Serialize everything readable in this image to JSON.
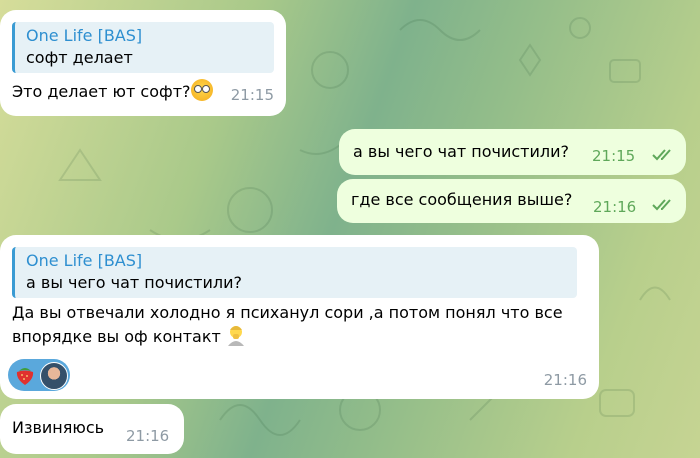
{
  "messages": [
    {
      "reply_author": "One Life [BAS]",
      "reply_text": "софт делает",
      "text": "Это делает ют софт?",
      "emoji": "flushed-face",
      "time": "21:15"
    },
    {
      "text": "а вы чего чат почистили?",
      "time": "21:15",
      "status": "read"
    },
    {
      "text": "где все сообщения выше?",
      "time": "21:16",
      "status": "read"
    },
    {
      "reply_author": "One Life [BAS]",
      "reply_text": "а вы чего чат почистили?",
      "text_line1": "Да вы отвечали холодно я психанул сори ,а потом понял что все",
      "text_line2": "впорядке вы оф контакт",
      "emoji": "person-facepalming",
      "reaction_emoji": "strawberry",
      "time": "21:16"
    },
    {
      "text": "Извиняюсь",
      "time": "21:16"
    }
  ],
  "colors": {
    "incoming_bubble": "#ffffff",
    "outgoing_bubble": "#eeffde",
    "reply_accent": "#3a9bd3",
    "read_ticks": "#5fa85a",
    "reaction_bg": "#5aa8dc"
  }
}
